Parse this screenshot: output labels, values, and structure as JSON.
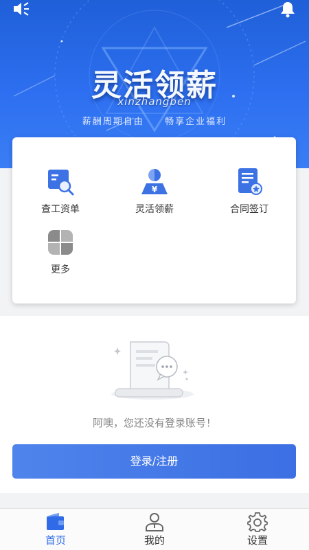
{
  "hero": {
    "title": "灵活领薪",
    "subtitle": "xinzhangben",
    "slogan_left": "薪酬周期自由",
    "slogan_right": "畅享企业福利"
  },
  "features": [
    {
      "label": "查工资单",
      "icon": "payslip-search-icon"
    },
    {
      "label": "灵活领薪",
      "icon": "salary-person-icon"
    },
    {
      "label": "合同签订",
      "icon": "contract-icon"
    },
    {
      "label": "更多",
      "icon": "more-icon"
    }
  ],
  "empty_state": {
    "message": "阿噢，您还没有登录账号！"
  },
  "login_button": "登录/注册",
  "tabbar": [
    {
      "label": "首页",
      "icon": "wallet-icon",
      "active": true
    },
    {
      "label": "我的",
      "icon": "user-icon",
      "active": false
    },
    {
      "label": "设置",
      "icon": "gear-icon",
      "active": false
    }
  ],
  "colors": {
    "primary": "#2f6be6",
    "hero_blue": "#2d6ff0",
    "button_blue": "#4f84ec"
  }
}
